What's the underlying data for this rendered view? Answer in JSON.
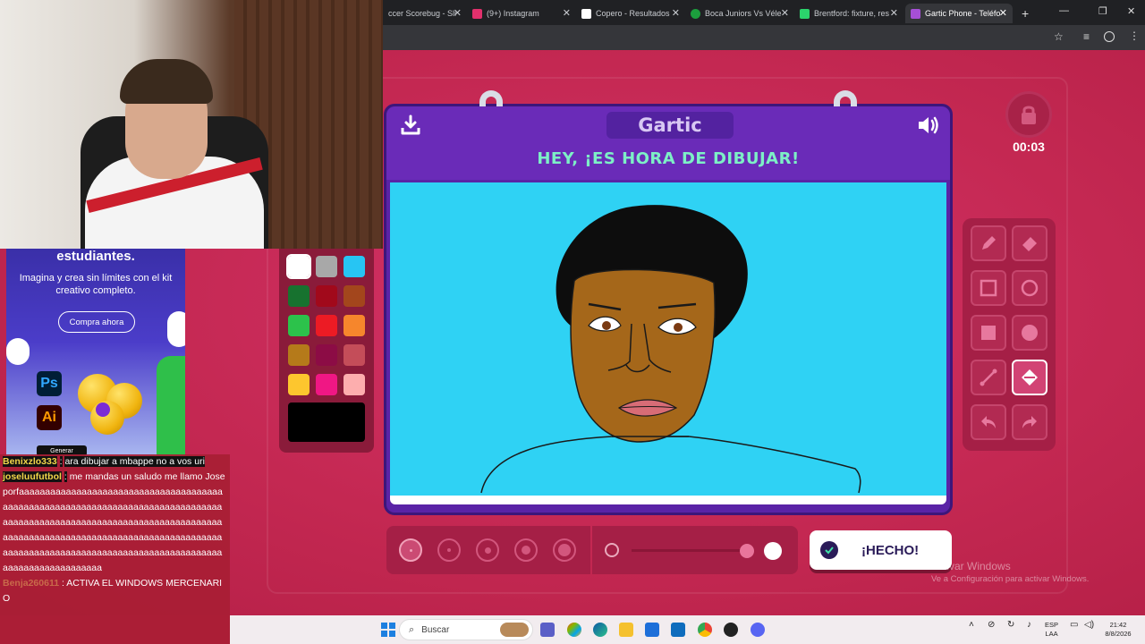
{
  "browser": {
    "tabs": [
      {
        "label": "ccer Scorebug - Sli",
        "icon_color": "#444"
      },
      {
        "label": "(9+) Instagram",
        "icon_color": "#e1306c"
      },
      {
        "label": "Copero - Resultados",
        "icon_color": "#fff"
      },
      {
        "label": "Boca Juniors Vs Véle",
        "icon_color": "#1c9e3d"
      },
      {
        "label": "Brentford: fixture, res",
        "icon_color": "#2bd36c"
      },
      {
        "label": "Gartic Phone - Teléfo",
        "icon_color": "#a64fd6"
      }
    ],
    "new_tab": "+"
  },
  "chat": {
    "messages": [
      {
        "user": "Benixzlo333",
        "text": "ara dibujar a mbappe no a vos uri"
      },
      {
        "user": "joseluufutbol",
        "text": "me mandas un saludo me llamo Jose"
      },
      {
        "user": "",
        "text": "porfaaaaaaaaaaaaaaaaaaaaaaaaaaaaaaaaaaaaaaaaaaaaaaaaaaaaaaaaaaaaaaaaaaaaaaaaaaaaaaaaaaaaaaaaaaaaaaaaaaaaaaaaaaaaaaaaaaaaaaaaaaaaaaaaaaaaaaaaaaaaaaaaaaaaaaaaaaaaaaaaaaaaaaaaaaaaaaaaaaaaaaaaaaaaaaaaaaaaaaaaaaaaaaaaaaaaaaaaaaaaaaaaaa"
      },
      {
        "user": "Benja260611",
        "text": "ACTIVA EL WINDOWS MERCENARIO"
      }
    ]
  },
  "ad": {
    "headline": "estudiantes.",
    "subtitle": "Imagina y crea sin límites con el kit creativo completo.",
    "cta": "Compra ahora",
    "ps_label": "Ps",
    "ai_label": "Ai",
    "generate_label": "Generar"
  },
  "palette": {
    "colors": [
      "#ffffff",
      "#a8a8a8",
      "#27c5f3",
      "#17722f",
      "#a1091b",
      "#a3461c",
      "#2cc24b",
      "#ec1b24",
      "#f6862c",
      "#b57a1a",
      "#8c0c45",
      "#c44d59",
      "#fdc62e",
      "#f01784",
      "#fdaeae"
    ],
    "selected_color": "#000000"
  },
  "card": {
    "logo": "Gartic",
    "prompt": "HEY, ¡ES HORA DE DIBUJAR!",
    "canvas_bg": "#2fd2f4"
  },
  "timer": {
    "value": "00:03"
  },
  "tools": [
    "pencil",
    "eraser",
    "rectangle-outline",
    "ellipse-outline",
    "rectangle-filled",
    "ellipse-filled",
    "line",
    "fill-bucket",
    "undo",
    "redo"
  ],
  "active_tool": "fill-bucket",
  "brush": {
    "sizes": 5,
    "selected_size": 1,
    "opacity_percent": 100
  },
  "done_button": {
    "label": "¡HECHO!"
  },
  "watermark": {
    "line1": "Activar Windows",
    "line2": "Ve a Configuración para activar Windows."
  },
  "taskbar": {
    "search_placeholder": "Buscar",
    "lang": "ESP",
    "lang2": "LAA",
    "time": "21:42",
    "date": "8/8/2026"
  }
}
